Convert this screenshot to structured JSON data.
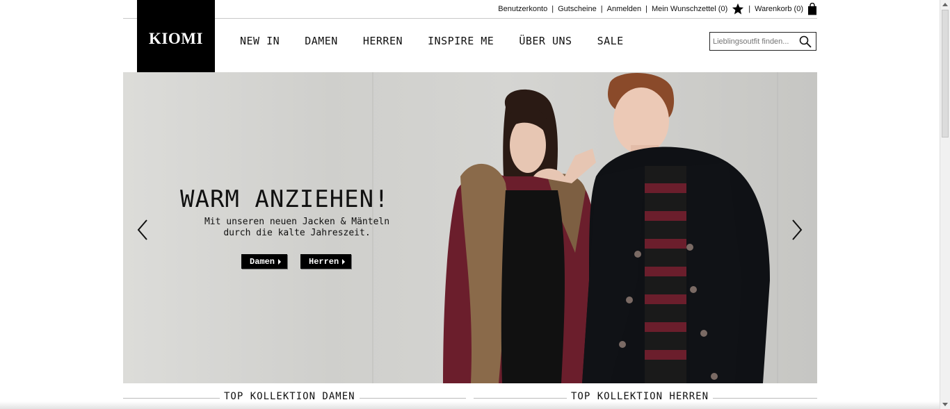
{
  "top_links": {
    "account": "Benutzerkonto",
    "vouchers": "Gutscheine",
    "login": "Anmelden",
    "wishlist": "Mein Wunschzettel (0)",
    "cart": "Warenkorb (0)",
    "separator": "|"
  },
  "logo": {
    "text": "KIOMI"
  },
  "nav": [
    {
      "label": "NEW IN"
    },
    {
      "label": "DAMEN"
    },
    {
      "label": "HERREN"
    },
    {
      "label": "INSPIRE ME"
    },
    {
      "label": "ÜBER UNS"
    },
    {
      "label": "SALE"
    }
  ],
  "search": {
    "placeholder": "Lieblingsoutfit finden...",
    "icon": "search-icon"
  },
  "hero": {
    "headline": "WARM ANZIEHEN!",
    "subline_1": "Mit unseren neuen Jacken & Mänteln",
    "subline_2": "durch die kalte Jahreszeit.",
    "cta_women": "Damen",
    "cta_men": "Herren",
    "prev_icon": "chevron-left-icon",
    "next_icon": "chevron-right-icon"
  },
  "sections": {
    "women": "TOP KOLLEKTION DAMEN",
    "men": "TOP KOLLEKTION HERREN"
  },
  "colors": {
    "brand_black": "#000000",
    "coat_burgundy": "#6b1e2c",
    "fur": "#8a6a4a"
  }
}
